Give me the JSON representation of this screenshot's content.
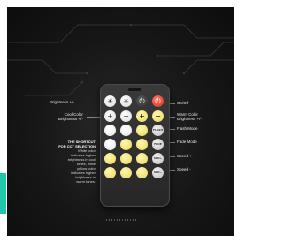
{
  "labels": {
    "brightness_up_down": "Brightness +/-",
    "on_off": "On/Off",
    "cool_color": "Cool Color\nBrightness +/-",
    "warm_color": "Warm Color\nBrightness +/-",
    "flash_mode": "Flash Mode",
    "fade_mode": "Fade Mode",
    "speed_plus": "Speed +",
    "speed_minus": "Speed -"
  },
  "note": {
    "heading": "THE SHORTCUT\nFOR CCT SELECTION",
    "body": "White color\nindicates higher\nbrightness in cool\ntones, while\nyellow color\nindicates higher\nbrightness in\nwarm tones."
  },
  "buttons": {
    "row1": [
      "☀",
      "☀",
      "⏻",
      "⏻"
    ],
    "row2": [
      "+",
      "−",
      "+",
      "−"
    ],
    "mode": [
      "FLASH",
      "FADE",
      "SPD+",
      "SPD−"
    ]
  },
  "colors": {
    "background": "#161616",
    "accent": "#22c7a9",
    "warm": "#e8d75a",
    "power": "#d62d1e"
  }
}
